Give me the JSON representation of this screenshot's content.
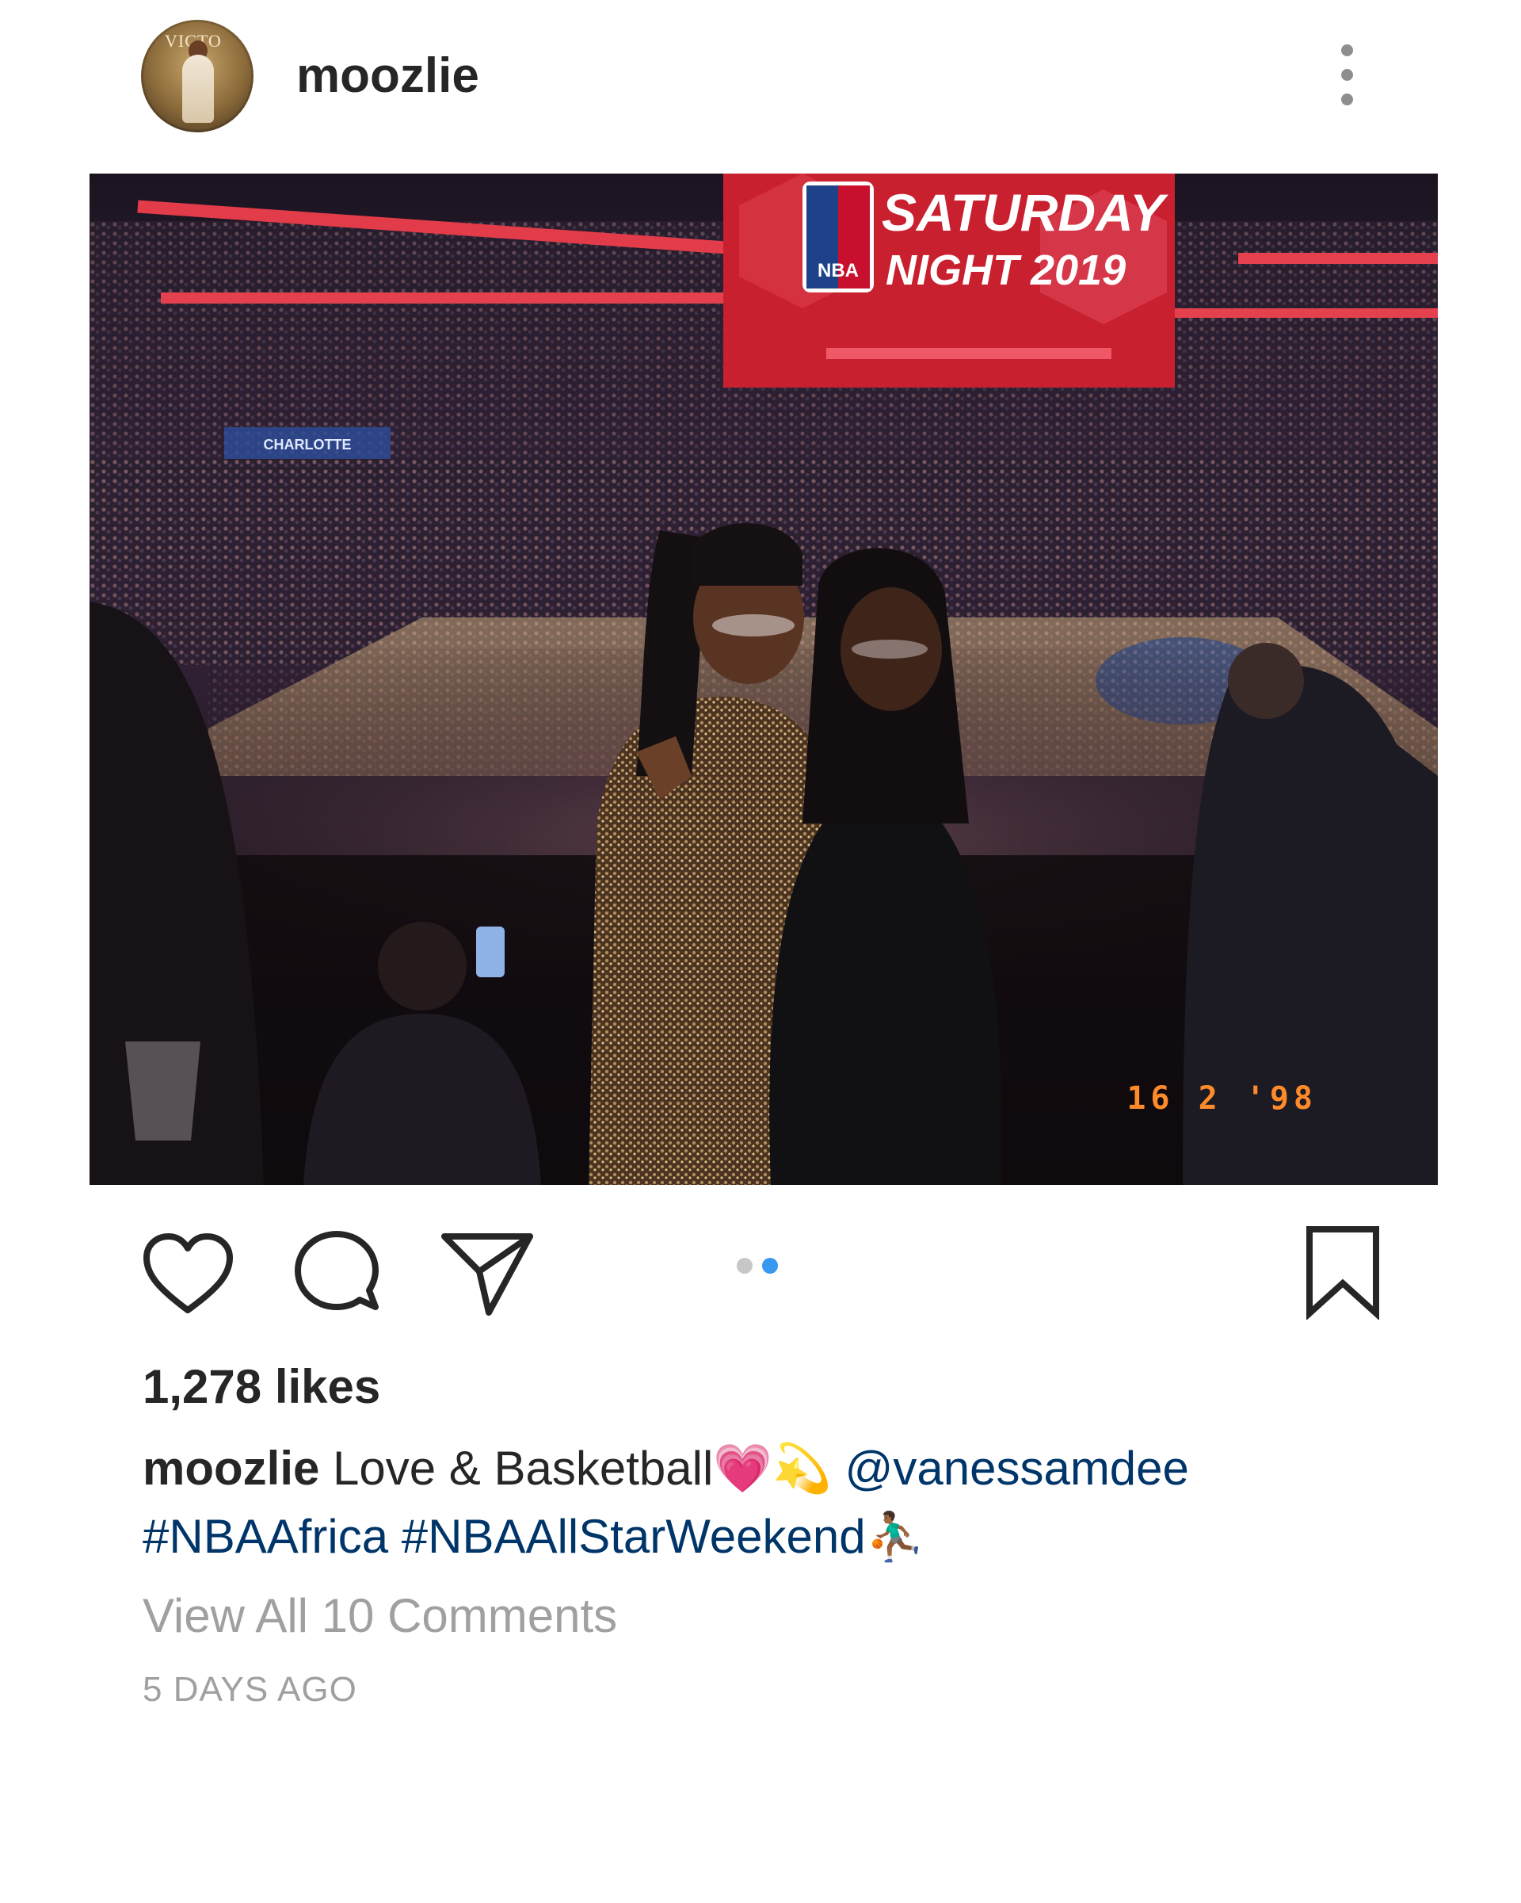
{
  "header": {
    "username": "moozlie",
    "avatar_text": "VICTO",
    "more_icon": "more-vertical-icon"
  },
  "photo": {
    "scoreboard_line1": "SATURDAY",
    "scoreboard_line2": "NIGHT 2019",
    "scoreboard_logo": "NBA",
    "arena_banner": "CHARLOTTE",
    "date_stamp": "16 2 '98"
  },
  "actions": {
    "like_icon": "heart-icon",
    "comment_icon": "comment-icon",
    "share_icon": "paper-plane-icon",
    "save_icon": "bookmark-icon",
    "carousel_count": 2,
    "carousel_active_index": 1,
    "carousel_active_color": "#3897f0",
    "carousel_inactive_color": "#c7c7c7"
  },
  "post": {
    "likes": "1,278 likes",
    "caption_user": "moozlie",
    "caption_text": "Love & Basketball",
    "caption_emoji_1": "💗",
    "caption_emoji_2": "💫",
    "mention": "@vanessamdee",
    "hashtag_1": "#NBAAfrica",
    "hashtag_2": "#NBAAllStarWeekend",
    "caption_emoji_3": "⛹🏾",
    "caption_emoji_4": "‍♂",
    "view_comments": "View All 10 Comments",
    "timestamp": "5 DAYS AGO"
  },
  "colors": {
    "link": "#003569",
    "secondary_text": "#a0a0a0",
    "text": "#262626"
  }
}
